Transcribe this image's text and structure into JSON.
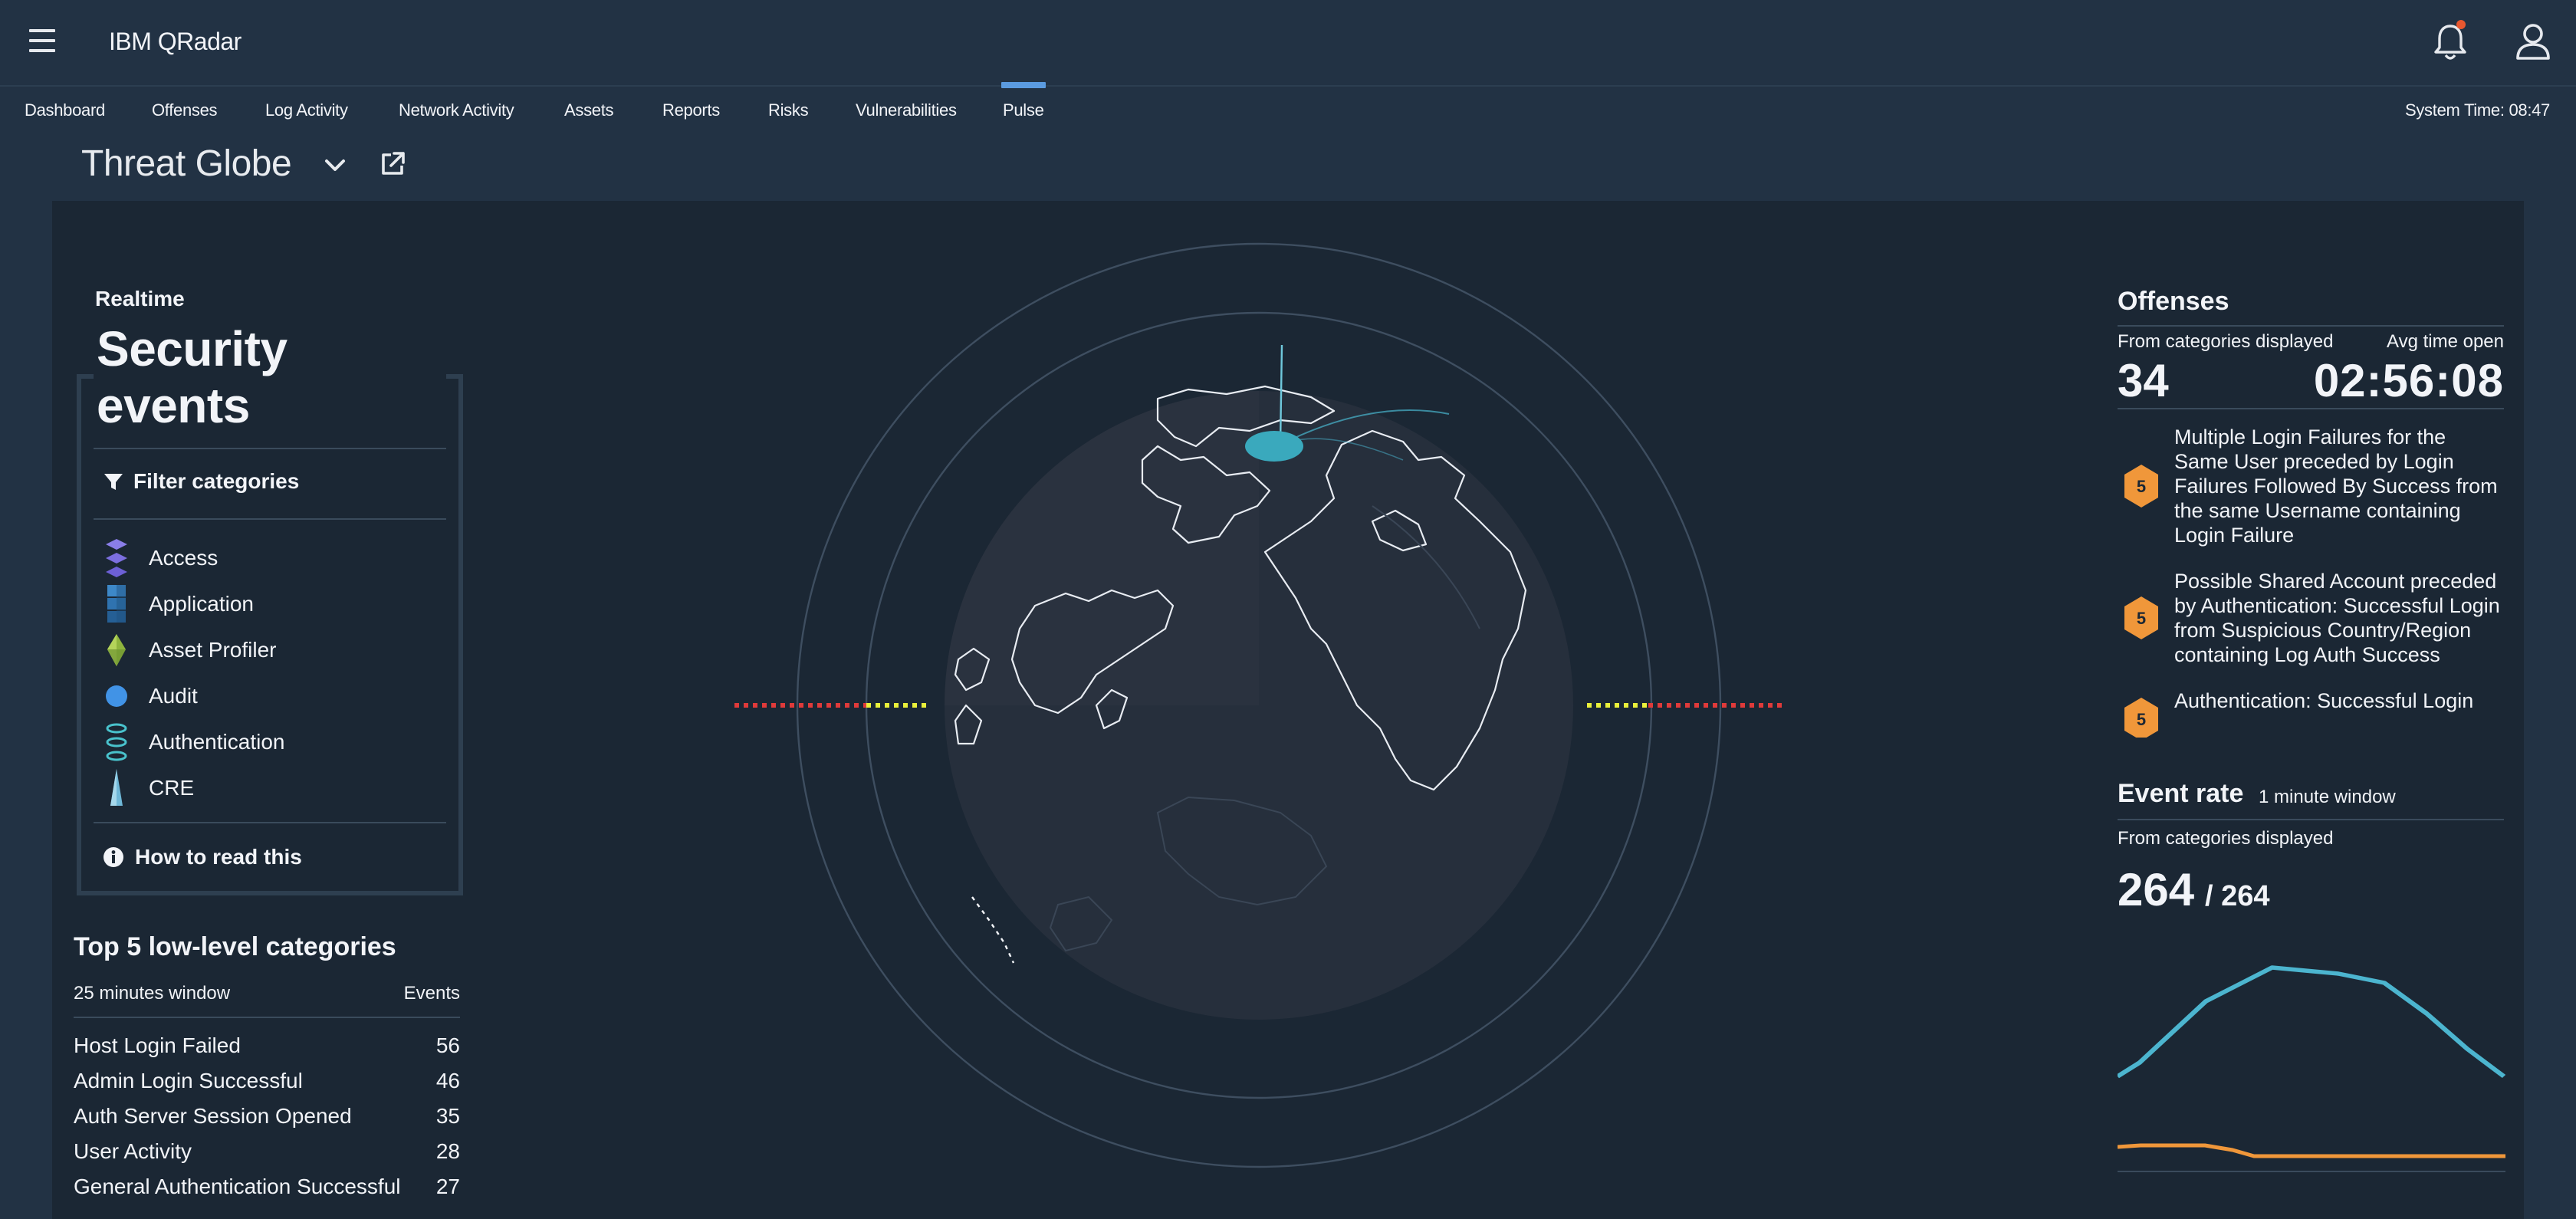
{
  "header": {
    "app_title": "IBM QRadar",
    "menu_icon": "hamburger-menu-icon",
    "notification_icon": "bell-icon",
    "user_icon": "user-icon",
    "notification_color": "#e8572f"
  },
  "nav": {
    "tabs": [
      {
        "label": "Dashboard",
        "active": false
      },
      {
        "label": "Offenses",
        "active": false
      },
      {
        "label": "Log Activity",
        "active": false
      },
      {
        "label": "Network Activity",
        "active": false
      },
      {
        "label": "Assets",
        "active": false
      },
      {
        "label": "Reports",
        "active": false
      },
      {
        "label": "Risks",
        "active": false
      },
      {
        "label": "Vulnerabilities",
        "active": false
      },
      {
        "label": "Pulse",
        "active": true
      }
    ],
    "system_time": "System Time: 08:47"
  },
  "page": {
    "title": "Threat Globe"
  },
  "security_events": {
    "realtime_label": "Realtime",
    "title": "Security events",
    "filter_label": "Filter categories",
    "categories": [
      {
        "label": "Access",
        "icon": "stacked-diamonds-icon"
      },
      {
        "label": "Application",
        "icon": "cubes-icon"
      },
      {
        "label": "Asset Profiler",
        "icon": "crystal-icon"
      },
      {
        "label": "Audit",
        "icon": "circle-icon"
      },
      {
        "label": "Authentication",
        "icon": "rings-icon"
      },
      {
        "label": "CRE",
        "icon": "spike-icon"
      }
    ],
    "how_to_read": "How to read this"
  },
  "top5": {
    "title": "Top 5 low-level categories",
    "window_label": "25 minutes window",
    "events_label": "Events",
    "rows": [
      {
        "name": "Host Login Failed",
        "count": "56"
      },
      {
        "name": "Admin Login Successful",
        "count": "46"
      },
      {
        "name": "Auth Server Session Opened",
        "count": "35"
      },
      {
        "name": "User Activity",
        "count": "28"
      },
      {
        "name": "General Authentication Successful",
        "count": "27"
      }
    ]
  },
  "offenses": {
    "title": "Offenses",
    "sub_left": "From categories displayed",
    "sub_right": "Avg time open",
    "count": "34",
    "avg_time": "02:56:08",
    "items": [
      {
        "severity": "5",
        "text": "Multiple Login Failures for the Same User preceded by Login Failures Followed By Success from the same Username containing Login Failure"
      },
      {
        "severity": "5",
        "text": "Possible Shared Account preceded by Authentication: Successful Login from Suspicious Country/Region containing Log Auth Success"
      },
      {
        "severity": "5",
        "text": "Authentication: Successful Login"
      }
    ],
    "severity_color": "#f0973a"
  },
  "event_rate": {
    "title": "Event rate",
    "window": "1 minute window",
    "sub": "From categories displayed",
    "value": "264",
    "total": "/ 264",
    "line_colors": {
      "primary": "#4cb5cf",
      "secondary": "#f0973a"
    }
  }
}
